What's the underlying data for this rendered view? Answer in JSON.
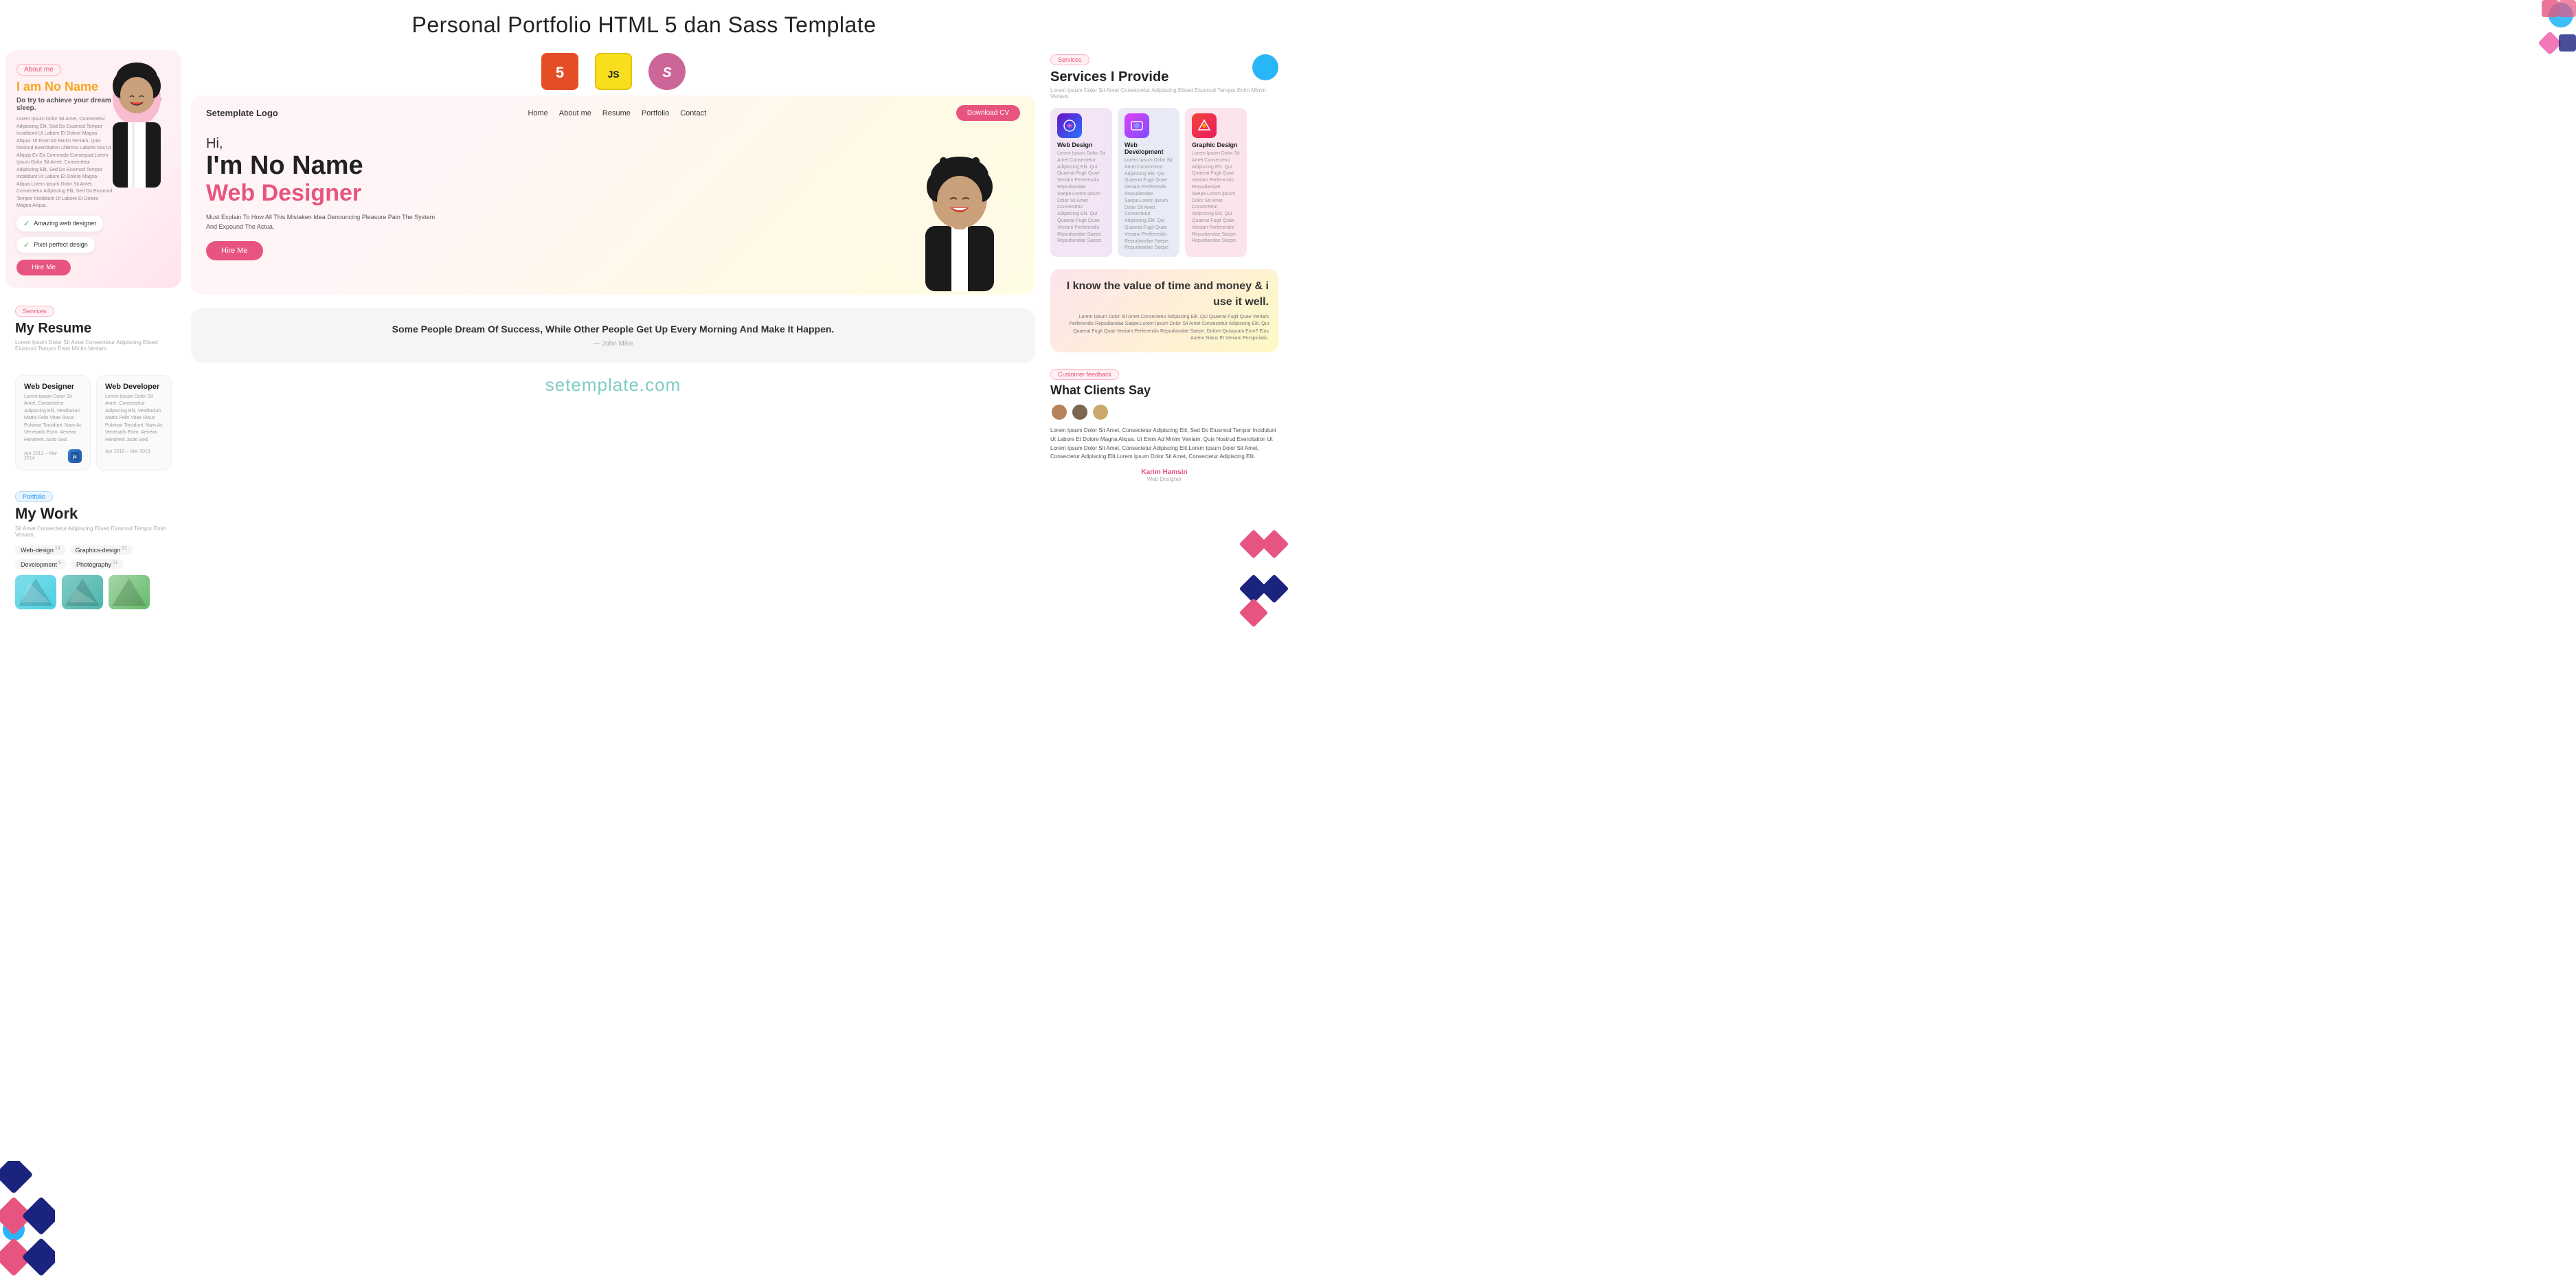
{
  "page": {
    "title": "Personal Portfolio HTML 5 dan Sass Template"
  },
  "left": {
    "hero": {
      "about_badge": "About me",
      "greeting": "I am ",
      "name": "No Name",
      "tagline": "Do try to achieve your dream by work,not by sleep.",
      "desc": "Lorem Ipsum Dolor Sit Amet, Consectetur Adipiscing Elit, Sed Do Eiusmod Tempor Incididunt Ut Labore Et Dolore Magna Aliqua. Ut Enim Ad Minim Veniam, Quis Nostrud Exercitation Ullamco Laboris Nisi Ut Aliquip Ex Ea Commodo Consequat.Lorem Ipsum Dolor Sit Amet, Consectetur Adipiscing Elit, Sed Do Eiusmod Tempor Incididunt Ut Labore Et Dolore Magna Aliqua.Lorem Ipsum Dolor Sit Amet, Consectetur Adipiscing Elit, Sed Do Eiusmod Tempor Incididunt Ut Labore Et Dolore Magna Aliqua.",
      "badge1": "Amazing web designer",
      "badge2": "Pixel perfect design",
      "hire_btn": "Hire Me"
    },
    "services": {
      "badge": "Services",
      "title": "My Resume",
      "subtitle": "Lorem Ipsum Dolor Sit Amet Consectetur Adipiscing Eiised Eiusmod Tempor Enim Minim Veniam."
    },
    "resume": {
      "badge": "Services",
      "title": "My Resume",
      "subtitle": "Lorem Ipsum Dolor Sit Amet Consectetur Adipiscing Eiised Eiusmod Tempor Enim Minim Veniam.",
      "cards": [
        {
          "title": "Web Designer",
          "desc": "Lorem Ipsum Dolor Sit Amet, Consectetur Adipiscing Elit, Vestibulum Mattis Felis Vitae Risus Pulvinar Tincidunt. Nam Ac Venenatis Enim. Aenean Hendrerit Justo Sed.",
          "date": "Apr 2013 - Mar 2014"
        },
        {
          "title": "Web Developer",
          "desc": "Lorem Ipsum Dolor Sit Amet, Consectetur Adipiscing Elit, Vestibulum Mattis Felis Vitae Risus Pulvinar Tincidunt. Nam Ac Venenatis Enim. Aenean Hendrerit Justo Sed.",
          "date": "Apr 2018 - Mar 2019"
        }
      ]
    },
    "portfolio": {
      "badge": "Portfolio",
      "title": "My Work",
      "subtitle": "Sit Amet Consectetur Adipiscing Eiised Eiusmod Tempor Enim Veniam.",
      "tabs": [
        {
          "label": "Web-design",
          "count": "14"
        },
        {
          "label": "Graphics-design",
          "count": "21"
        },
        {
          "label": "Development",
          "count": "8"
        },
        {
          "label": "Photography",
          "count": "11"
        }
      ]
    }
  },
  "middle": {
    "tech_icons": [
      {
        "name": "HTML5",
        "symbol": "5"
      },
      {
        "name": "JavaScript",
        "symbol": "JS"
      },
      {
        "name": "Sass",
        "symbol": "S"
      }
    ],
    "navbar": {
      "logo": "Setemplate Logo",
      "links": [
        "Home",
        "About me",
        "Resume",
        "Portfolio",
        "Contact"
      ],
      "download_btn": "Download CV"
    },
    "hero": {
      "hi": "Hi,",
      "name": "I'm No Name",
      "title": "Web Designer",
      "subtitle": "Must Explain To How All This Mistaken Idea Denouncing Pleasure Pain The System And Expound The Actua.",
      "hire_btn": "Hire Me"
    },
    "quote": {
      "text": "I know the value of time and money & i use it well.",
      "desc": "Lorem Ipsum Dolor Sit Amet Consectetur Adipiscing Elit. Qui Quaerat Fugit Quae Veniam Perferendis Repudiandae Saepe.Lorem Ipsum Dolor Sit Amet Consectetur Adipiscing Elit. Qui Quaerat Fugit Quae Veniam Perferendis Repudiandae Saepe. Dolore Quisquam Eum? Eius Autem Natus Et Veniam Perspiciatis."
    },
    "success_quote": {
      "text": "Some People Dream Of Success, While Other People Get Up Every Morning And Make It Happen.",
      "author": "— John Mike"
    },
    "footer": {
      "site": "setemplate.com"
    }
  },
  "right": {
    "services": {
      "badge": "Services",
      "title": "Services I Provide",
      "subtitle": "Lorem Ipsum Dolor Sit Amet Consectetur Adipiscing Eiised Eiusmod Tempor Enim Minim Veniam.",
      "cards": [
        {
          "title": "Web Design",
          "desc": "Lorem Ipsum Dolor Sit Amet Consectetur Adipiscing Elit. Qui Quaerat Fugit Quae Veniam Perferendis Repudiandae Saepe.Lorem Ipsum Dolor Sit Amet Consectetur Adipiscing Elit. Qui Quaerat Fugit Quae Veniam Perferendis Repudiandae Saepe. Repudiandae Saepe.",
          "icon": "🎨"
        },
        {
          "title": "Web Development",
          "desc": "Lorem Ipsum Dolor Sit Amet Consectetur Adipiscing Elit. Qui Quaerat Fugit Quae Veniam Perferendis Repudiandae Saepe.Lorem Ipsum Dolor Sit Amet Consectetur Adipiscing Elit. Qui Quaerat Fugit Quae Veniam Perferendis Repudiandae Saepe. Repudiandae Saepe.",
          "icon": "💻"
        },
        {
          "title": "Graphic Design",
          "desc": "Lorem Ipsum Dolor Sit Amet Consectetur Adipiscing Elit. Qui Quaerat Fugit Quae Veniam Perferendis Repudiandae Saepe.Lorem Ipsum Dolor Sit Amet Consectetur Adipiscing Elit. Qui Quaerat Fugit Quae Veniam Perferendis Repudiandae Saepe. Repudiandae Saepe.",
          "icon": "✏️"
        }
      ]
    },
    "quote_value": {
      "text": "I know the value of time and money & i use it well.",
      "desc": "Lorem Ipsum Dolor Sit Amet Consectetur Adipiscing Elit. Qui Quaerat Fugit Quae Veniam Perferendis Repudiandae Saepe.Lorem Ipsum Dolor Sit Amet Consectetur Adipiscing Elit. Qui Quaerat Fugit Quae Veniam Perferendis Repudiandae Saepe. Dolore Quisquam Eum? Eius Autem Natus Et Veniam Perspiciatis."
    },
    "testimonial": {
      "badge": "Customer feedback",
      "title": "What Clients Say",
      "text": "Lorem Ipsum Dolor Sit Amet, Consectetur Adipiscing Elit, Sed Do Eiusmod Tempor Incididunt Ut Labore Et Dolore Magna Aliqua. Ut Enim Ad Minim Veniam, Quis Nostrud Exercitation Ut Lorem Ipsum Dolor Sit Amet, Consectetur Adipiscing Elit.Lorem Ipsum Dolor Sit Amet, Consectetur Adipiscing Elit.Lorem Ipsum Dolor Sit Amet, Consectetur Adipiscing Elit.",
      "author": "Karim Hamsin",
      "role": "Web Designer"
    }
  }
}
